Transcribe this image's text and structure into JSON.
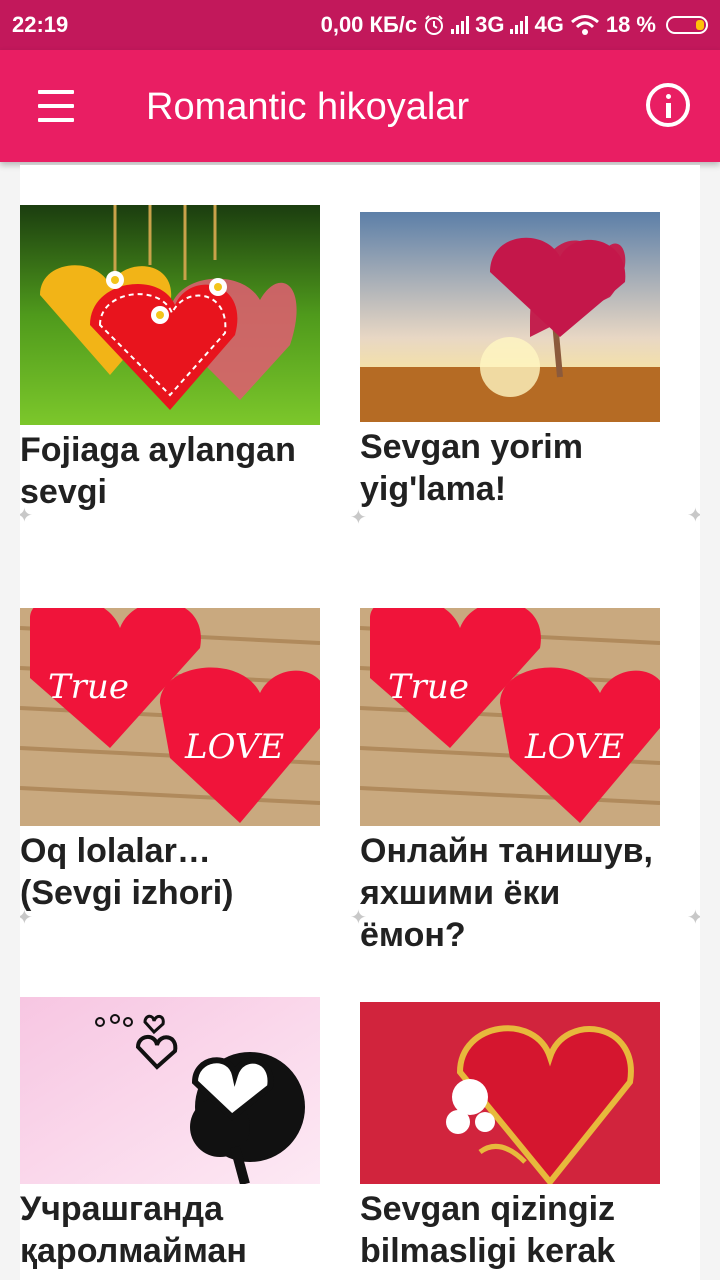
{
  "status_bar": {
    "time": "22:19",
    "speed": "0,00 КБ/с",
    "net1": "3G",
    "net2": "4G",
    "battery": "18 %"
  },
  "app_bar": {
    "title": "Romantic hikoyalar",
    "menu_icon": "hamburger-menu-icon",
    "info_icon": "info-icon"
  },
  "stories": [
    {
      "title": "Fojiaga aylangan sevgi",
      "image": "hanging-hearts"
    },
    {
      "title": "Sevgan yorim yig'lama!",
      "image": "heart-tree"
    },
    {
      "title": "Oq lolalar… (Sevgi izhori)",
      "image": "true-love-hearts"
    },
    {
      "title": "Онлайн танишув, яхшими ёки ёмон?",
      "image": "true-love-hearts"
    },
    {
      "title": "Учрашганда қаролмайман",
      "image": "silhouette-hearts"
    },
    {
      "title": "Sevgan qizingiz bilmasligi kerak",
      "image": "golden-heart"
    }
  ],
  "true_love_text": {
    "word1": "True",
    "word2": "LOVE"
  },
  "colors": {
    "status_bar": "#c2185b",
    "app_bar": "#e91e63",
    "accent": "#e91e63"
  }
}
